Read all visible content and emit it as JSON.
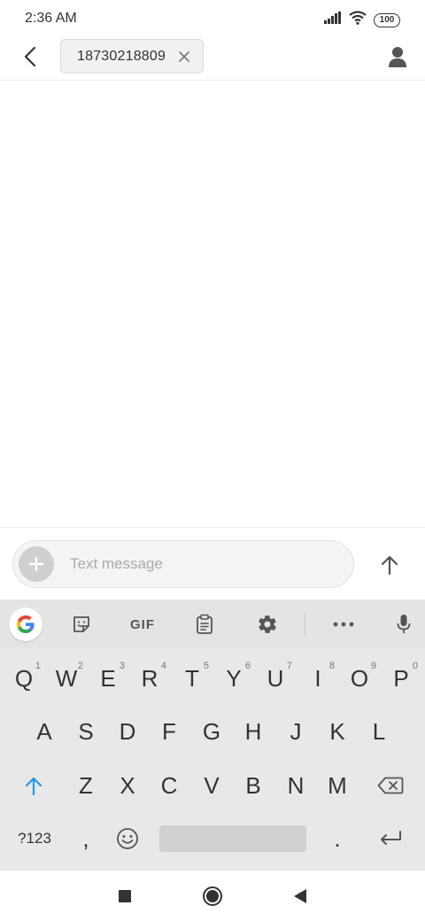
{
  "status_bar": {
    "time": "2:36 AM",
    "battery": "100"
  },
  "top_bar": {
    "recipient": "18730218809"
  },
  "compose": {
    "placeholder": "Text message"
  },
  "keyboard": {
    "toolbar": {
      "gif_label": "GIF"
    },
    "row1": [
      {
        "label": "Q",
        "sub": "1"
      },
      {
        "label": "W",
        "sub": "2"
      },
      {
        "label": "E",
        "sub": "3"
      },
      {
        "label": "R",
        "sub": "4"
      },
      {
        "label": "T",
        "sub": "5"
      },
      {
        "label": "Y",
        "sub": "6"
      },
      {
        "label": "U",
        "sub": "7"
      },
      {
        "label": "I",
        "sub": "8"
      },
      {
        "label": "O",
        "sub": "9"
      },
      {
        "label": "P",
        "sub": "0"
      }
    ],
    "row2": [
      "A",
      "S",
      "D",
      "F",
      "G",
      "H",
      "J",
      "K",
      "L"
    ],
    "row3": [
      "Z",
      "X",
      "C",
      "V",
      "B",
      "N",
      "M"
    ],
    "row4": {
      "symbols": "?123",
      "comma": ",",
      "period": "."
    }
  },
  "colors": {
    "shift_accent": "#2196f3",
    "keyboard_bg": "#e8e8e8",
    "google_blue": "#4285F4",
    "google_red": "#EA4335",
    "google_yellow": "#FBBC05",
    "google_green": "#34A853"
  },
  "icons": {
    "back": "chevron-left-icon",
    "chip_close": "close-icon",
    "contact": "person-icon",
    "add": "plus-icon",
    "send": "arrow-up-icon",
    "sticker": "sticker-icon",
    "clipboard": "clipboard-icon",
    "settings": "gear-icon",
    "more": "more-horizontal-icon",
    "mic": "mic-icon",
    "shift": "shift-icon",
    "backspace": "backspace-icon",
    "emoji": "emoji-icon",
    "enter": "enter-icon",
    "nav_recents": "square-icon",
    "nav_home": "circle-icon",
    "nav_back": "triangle-back-icon"
  }
}
